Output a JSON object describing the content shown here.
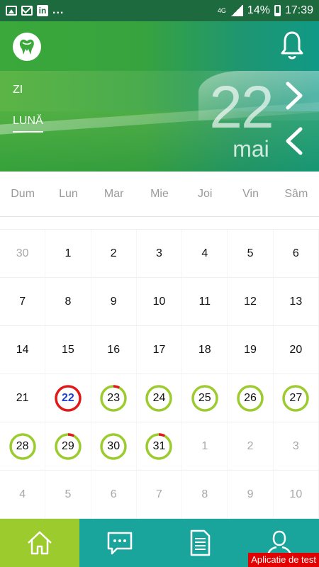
{
  "status_bar": {
    "notification_icons": [
      "image-icon",
      "mail-icon",
      "linkedin-icon"
    ],
    "linkedin_text": "in",
    "more": "...",
    "network": "4G",
    "battery_percent": "14%",
    "time": "17:39"
  },
  "header": {
    "tab_day": "ZI",
    "tab_month": "LUNĂ",
    "selected_tab": "LUNĂ",
    "day_number": "22",
    "month_name": "mai"
  },
  "weekdays": [
    "Dum",
    "Lun",
    "Mar",
    "Mie",
    "Joi",
    "Vin",
    "Sâm"
  ],
  "calendar": {
    "today": 22,
    "weeks": [
      [
        {
          "d": "30",
          "muted": true
        },
        {
          "d": "1"
        },
        {
          "d": "2"
        },
        {
          "d": "3"
        },
        {
          "d": "4"
        },
        {
          "d": "5"
        },
        {
          "d": "6"
        }
      ],
      [
        {
          "d": "7"
        },
        {
          "d": "8"
        },
        {
          "d": "9"
        },
        {
          "d": "10"
        },
        {
          "d": "11"
        },
        {
          "d": "12"
        },
        {
          "d": "13"
        }
      ],
      [
        {
          "d": "14"
        },
        {
          "d": "15"
        },
        {
          "d": "16"
        },
        {
          "d": "17"
        },
        {
          "d": "18"
        },
        {
          "d": "19"
        },
        {
          "d": "20"
        }
      ],
      [
        {
          "d": "21"
        },
        {
          "d": "22",
          "ring": "today"
        },
        {
          "d": "23",
          "ring": "partial",
          "red": 0.08
        },
        {
          "d": "24",
          "ring": "full"
        },
        {
          "d": "25",
          "ring": "full"
        },
        {
          "d": "26",
          "ring": "full"
        },
        {
          "d": "27",
          "ring": "full"
        }
      ],
      [
        {
          "d": "28",
          "ring": "full"
        },
        {
          "d": "29",
          "ring": "partial",
          "red": 0.08
        },
        {
          "d": "30",
          "ring": "full"
        },
        {
          "d": "31",
          "ring": "partial",
          "red": 0.08
        },
        {
          "d": "1",
          "muted": true
        },
        {
          "d": "2",
          "muted": true
        },
        {
          "d": "3",
          "muted": true
        }
      ],
      [
        {
          "d": "4",
          "muted": true
        },
        {
          "d": "5",
          "muted": true
        },
        {
          "d": "6",
          "muted": true
        },
        {
          "d": "7",
          "muted": true
        },
        {
          "d": "8",
          "muted": true
        },
        {
          "d": "9",
          "muted": true
        },
        {
          "d": "10",
          "muted": true
        }
      ]
    ]
  },
  "colors": {
    "ring_green": "#9ccb2d",
    "ring_red": "#e11818",
    "nav_active": "#9ccb2d",
    "nav_bg": "#1aa59c"
  },
  "bottom_nav": {
    "items": [
      "home-icon",
      "chat-icon",
      "document-icon",
      "user-icon"
    ],
    "active": "home-icon",
    "test_badge": "Aplicatie de test"
  }
}
